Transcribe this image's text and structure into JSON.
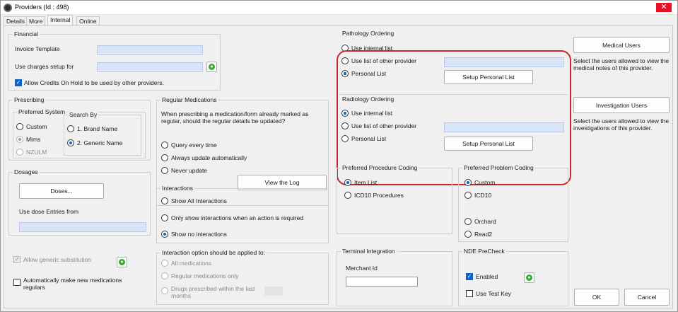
{
  "window": {
    "title": "Providers (Id : 498)",
    "close_glyph": "✕"
  },
  "tabs": [
    "Details",
    "More",
    "Internal",
    "Online"
  ],
  "financial": {
    "group_label": "Financial",
    "invoice_template_label": "Invoice Template",
    "invoice_template_value": "",
    "use_charges_label": "Use charges setup for",
    "use_charges_value": "",
    "allow_credits_label": "Allow Credits On Hold to be used by other providers.",
    "allow_credits_checked": true
  },
  "prescribing": {
    "group_label": "Prescribing",
    "preferred_system_label": "Preferred System",
    "systems": [
      {
        "label": "Custom",
        "selected": false,
        "enabled": true
      },
      {
        "label": "Mims",
        "selected": true,
        "enabled": false
      },
      {
        "label": "NZULM",
        "selected": false,
        "enabled": false
      }
    ],
    "search_by_label": "Search By",
    "search_options": [
      {
        "label": "1. Brand Name",
        "selected": false
      },
      {
        "label": "2. Generic Name",
        "selected": true
      }
    ]
  },
  "dosages": {
    "group_label": "Dosages",
    "doses_button": "Doses...",
    "use_dose_label": "Use dose Entries from",
    "use_dose_value": ""
  },
  "generic_substitution": {
    "label": "Allow generic substitution",
    "checked": true,
    "enabled": false
  },
  "auto_regulars": {
    "label": "Automatically make new medications regulars",
    "checked": false
  },
  "regular_medications": {
    "group_label": "Regular Medications",
    "description": "When prescribing a medication/form already marked as regular, should the regular details be updated?",
    "options": [
      {
        "label": "Query every time",
        "selected": false
      },
      {
        "label": "Always update automatically",
        "selected": false
      },
      {
        "label": "Never update",
        "selected": false
      }
    ],
    "view_log_button": "View the Log"
  },
  "interactions": {
    "group_label": "Interactions",
    "options": [
      {
        "label": "Show All Interactions",
        "selected": false
      },
      {
        "label": "Only show interactions when an action is required",
        "selected": false
      },
      {
        "label": "Show no interactions",
        "selected": true
      }
    ]
  },
  "interaction_apply": {
    "group_label": "Interaction option should be applied to:",
    "options": [
      {
        "label": "All medications",
        "selected": false
      },
      {
        "label": "Regular medications only",
        "selected": false
      },
      {
        "label": "Drugs prescribed within the last months",
        "selected": false
      }
    ]
  },
  "pathology": {
    "group_label": "Pathology Ordering",
    "options": [
      {
        "label": "Use internal list",
        "selected": false
      },
      {
        "label": "Use list of other provider",
        "selected": false
      },
      {
        "label": "Personal List",
        "selected": true
      }
    ],
    "provider_value": "",
    "setup_button": "Setup Personal List"
  },
  "radiology": {
    "group_label": "Radiology Ordering",
    "options": [
      {
        "label": "Use internal list",
        "selected": true
      },
      {
        "label": "Use list of other provider",
        "selected": false
      },
      {
        "label": "Personal List",
        "selected": false
      }
    ],
    "provider_value": "",
    "setup_button": "Setup Personal List"
  },
  "procedure_coding": {
    "group_label": "Preferred Procedure Coding",
    "options": [
      {
        "label": "Item List",
        "selected": true
      },
      {
        "label": "ICD10 Procedures",
        "selected": false
      }
    ]
  },
  "problem_coding": {
    "group_label": "Preferred Problem Coding",
    "options": [
      {
        "label": "Custom",
        "selected": true
      },
      {
        "label": "ICD10",
        "selected": false
      },
      {
        "label": "Orchard",
        "selected": false
      },
      {
        "label": "Read2",
        "selected": false
      }
    ]
  },
  "terminal": {
    "group_label": "Terminal Integration",
    "merchant_label": "Merchant Id",
    "merchant_value": ""
  },
  "nde": {
    "group_label": "NDE PreCheck",
    "enabled_label": "Enabled",
    "enabled_checked": true,
    "test_key_label": "Use Test Key",
    "test_key_checked": false
  },
  "medical_users": {
    "button": "Medical Users",
    "description": "Select the users allowed to view the medical notes of this provider."
  },
  "investigation_users": {
    "button": "Investigation Users",
    "description": "Select the users allowed to view the investigations of this provider."
  },
  "footer": {
    "ok": "OK",
    "cancel": "Cancel"
  },
  "colors": {
    "highlight": "#c8282a",
    "selection": "#0a64c8",
    "field": "#d8e4f8",
    "go_icon": "#3aa935",
    "close": "#e81123"
  }
}
